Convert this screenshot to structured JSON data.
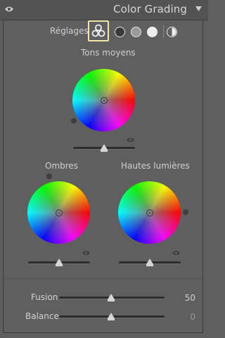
{
  "header": {
    "title": "Color Grading"
  },
  "adjust": {
    "label": "Réglages :",
    "modes": [
      "3-way",
      "shadows",
      "midtones",
      "highlights",
      "global"
    ],
    "selected_mode": "3-way"
  },
  "midtones": {
    "label": "Tons moyens",
    "luminance": 0.5
  },
  "shadows": {
    "label": "Ombres",
    "luminance": 0.5
  },
  "highlights": {
    "label": "Hautes lumières",
    "luminance": 0.5
  },
  "blending": {
    "label": "Fusion",
    "value": "50"
  },
  "balance": {
    "label": "Balance",
    "value": "0"
  },
  "colors": {
    "accent_selected": "#f0e6a8",
    "panel_bg": "#5f5f5f"
  }
}
